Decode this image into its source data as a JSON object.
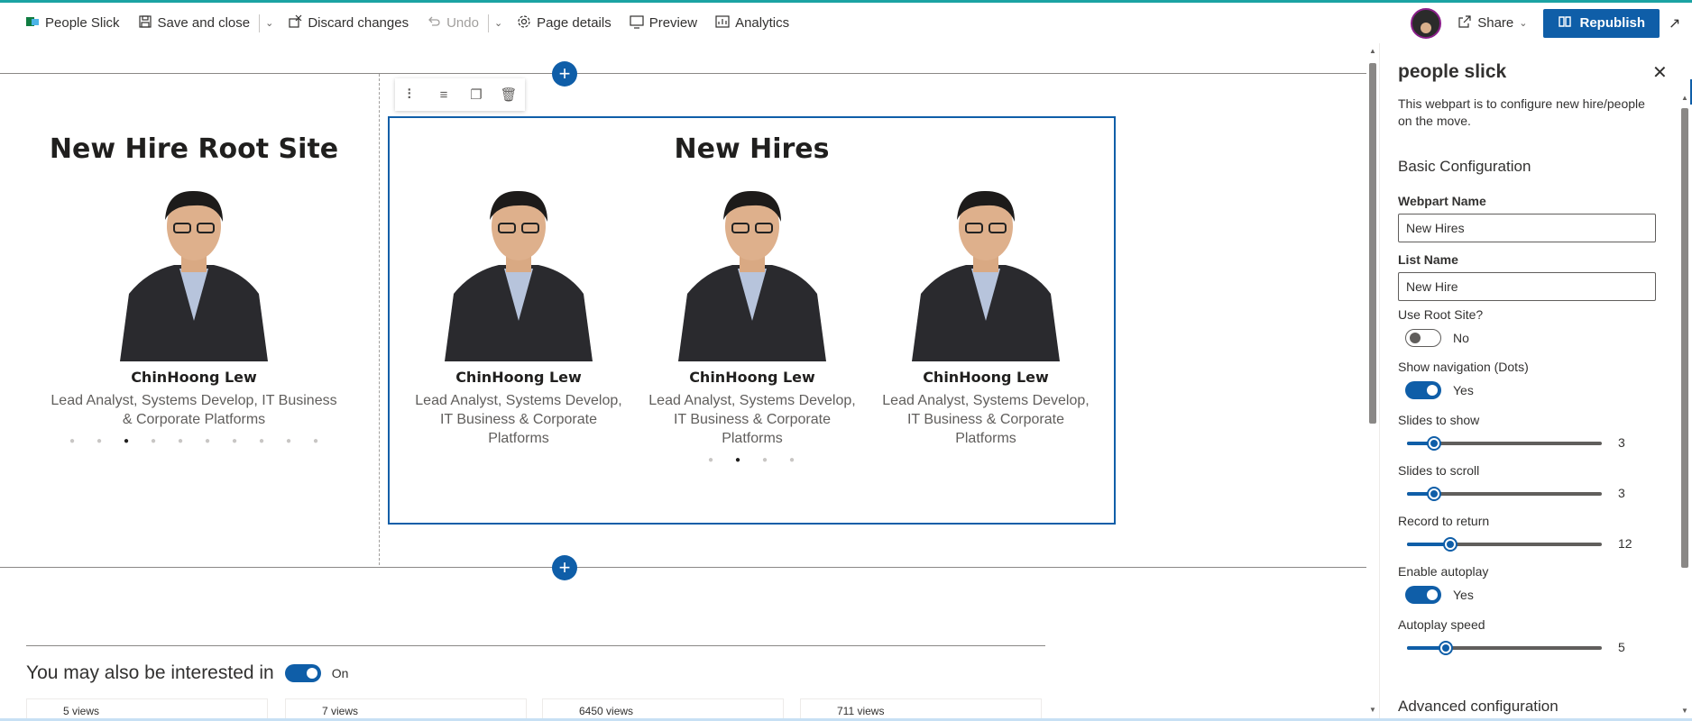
{
  "toolbar": {
    "app_name": "People Slick",
    "save_close": "Save and close",
    "discard": "Discard changes",
    "undo": "Undo",
    "page_details": "Page details",
    "preview": "Preview",
    "analytics": "Analytics",
    "share": "Share",
    "republish": "Republish"
  },
  "root_webpart": {
    "title": "New Hire Root Site",
    "person": {
      "name": "ChinHoong Lew",
      "role": "Lead Analyst, Systems Develop, IT Business & Corporate Platforms"
    },
    "dots_total": 10,
    "dots_active": 3
  },
  "new_hires_webpart": {
    "title": "New Hires",
    "people": [
      {
        "name": "ChinHoong Lew",
        "role": "Lead Analyst, Systems Develop, IT Business & Corporate Platforms"
      },
      {
        "name": "ChinHoong Lew",
        "role": "Lead Analyst, Systems Develop, IT Business & Corporate Platforms"
      },
      {
        "name": "ChinHoong Lew",
        "role": "Lead Analyst, Systems Develop, IT Business & Corporate Platforms"
      }
    ],
    "dots_total": 4,
    "dots_active": 2
  },
  "interested": {
    "title": "You may also be interested in",
    "toggle_label": "On",
    "cards": [
      "5 views",
      "7 views",
      "6450 views",
      "711 views"
    ]
  },
  "pane": {
    "title": "people slick",
    "description": "This webpart is to configure new hire/people on the move.",
    "basic_section": "Basic Configuration",
    "webpart_name_label": "Webpart Name",
    "webpart_name_value": "New Hires",
    "list_name_label": "List Name",
    "list_name_value": "New Hire",
    "use_root_label": "Use Root Site?",
    "use_root_state": "No",
    "use_root_on": false,
    "show_nav_label": "Show navigation (Dots)",
    "show_nav_state": "Yes",
    "show_nav_on": true,
    "slides_show_label": "Slides to show",
    "slides_show_value": "3",
    "slides_show_fraction": 0.14,
    "slides_scroll_label": "Slides to scroll",
    "slides_scroll_value": "3",
    "slides_scroll_fraction": 0.14,
    "record_label": "Record to return",
    "record_value": "12",
    "record_fraction": 0.22,
    "autoplay_label": "Enable autoplay",
    "autoplay_state": "Yes",
    "autoplay_on": true,
    "speed_label": "Autoplay speed",
    "speed_value": "5",
    "speed_fraction": 0.2,
    "advanced_section": "Advanced configuration"
  },
  "colors": {
    "accent": "#0f5ea8",
    "text": "#323130",
    "muted": "#605e5c"
  }
}
